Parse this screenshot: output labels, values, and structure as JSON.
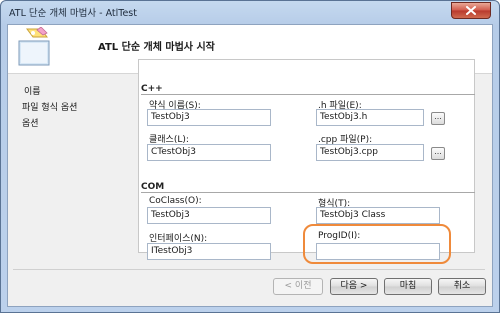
{
  "window": {
    "title": "ATL 단순 개체 마법사 - AtlTest",
    "header_title": "ATL 단순 개체 마법사 시작"
  },
  "nav": {
    "items": [
      {
        "label": "이름",
        "selected": true
      },
      {
        "label": "파일 형식 옵션",
        "selected": false
      },
      {
        "label": "옵션",
        "selected": false
      }
    ]
  },
  "cpp_section": {
    "title": "C++",
    "short_name": {
      "label": "약식 이름(S):",
      "value": "TestObj3"
    },
    "h_file": {
      "label": ".h 파일(E):",
      "value": "TestObj3.h",
      "browse": "..."
    },
    "class": {
      "label": "클래스(L):",
      "value": "CTestObj3"
    },
    "cpp_file": {
      "label": ".cpp 파일(P):",
      "value": "TestObj3.cpp",
      "browse": "..."
    }
  },
  "com_section": {
    "title": "COM",
    "coclass": {
      "label": "CoClass(O):",
      "value": "TestObj3"
    },
    "type": {
      "label": "형식(T):",
      "value": "TestObj3 Class"
    },
    "interface": {
      "label": "인터페이스(N):",
      "value": "ITestObj3"
    },
    "progid": {
      "label": "ProgID(I):",
      "value": ""
    }
  },
  "buttons": {
    "prev": "< 이전",
    "next": "다음 >",
    "finish": "마침",
    "cancel": "취소"
  },
  "colors": {
    "highlight": "#ef8a3b",
    "title_bar": "#b6cce8"
  }
}
